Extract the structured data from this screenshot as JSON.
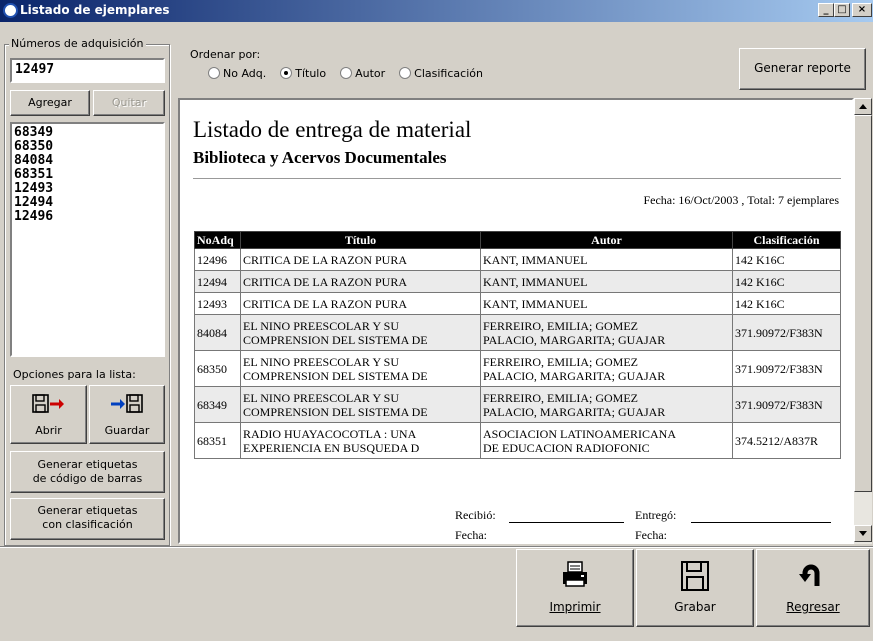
{
  "window": {
    "title": "Listado de ejemplares"
  },
  "adquisicion": {
    "group_label": "Números de adquisición",
    "input_value": "12497",
    "agregar_label": "Agregar",
    "quitar_label": "Quitar",
    "list": [
      "68349",
      "68350",
      "84084",
      "68351",
      "12493",
      "12494",
      "12496"
    ]
  },
  "opciones": {
    "label": "Opciones para la lista:",
    "abrir_label": "Abrir",
    "guardar_label": "Guardar",
    "barcode_label_1": "Generar  etiquetas",
    "barcode_label_2": "de código de barras",
    "clasif_label_1": "Generar etiquetas",
    "clasif_label_2": "con clasificación"
  },
  "ordenar": {
    "label": "Ordenar por:",
    "options": [
      "No Adq.",
      "Título",
      "Autor",
      "Clasificación"
    ],
    "selected": "Título"
  },
  "generar_reporte_label": "Generar reporte",
  "report": {
    "title": "Listado de entrega de material",
    "subtitle": "Biblioteca y Acervos Documentales",
    "fecha_line": "Fecha: 16/Oct/2003 , Total: 7 ejemplares",
    "columns": [
      "NoAdq",
      "Título",
      "Autor",
      "Clasificación"
    ],
    "rows": [
      {
        "noadq": "12496",
        "titulo_1": "CRITICA DE LA RAZON PURA",
        "titulo_2": "",
        "autor_1": "KANT, IMMANUEL",
        "autor_2": "",
        "clasif": "142 K16C"
      },
      {
        "noadq": "12494",
        "titulo_1": "CRITICA DE LA RAZON PURA",
        "titulo_2": "",
        "autor_1": "KANT, IMMANUEL",
        "autor_2": "",
        "clasif": "142 K16C"
      },
      {
        "noadq": "12493",
        "titulo_1": "CRITICA DE LA RAZON PURA",
        "titulo_2": "",
        "autor_1": "KANT, IMMANUEL",
        "autor_2": "",
        "clasif": "142 K16C"
      },
      {
        "noadq": "84084",
        "titulo_1": "EL NINO PREESCOLAR Y SU",
        "titulo_2": "COMPRENSION DEL SISTEMA DE",
        "autor_1": "FERREIRO, EMILIA; GOMEZ",
        "autor_2": "PALACIO, MARGARITA; GUAJAR",
        "clasif": "371.90972/F383N"
      },
      {
        "noadq": "68350",
        "titulo_1": "EL NINO PREESCOLAR Y SU",
        "titulo_2": "COMPRENSION DEL SISTEMA DE",
        "autor_1": "FERREIRO, EMILIA; GOMEZ",
        "autor_2": "PALACIO, MARGARITA; GUAJAR",
        "clasif": "371.90972/F383N"
      },
      {
        "noadq": "68349",
        "titulo_1": "EL NINO PREESCOLAR Y SU",
        "titulo_2": "COMPRENSION DEL SISTEMA DE",
        "autor_1": "FERREIRO, EMILIA; GOMEZ",
        "autor_2": "PALACIO, MARGARITA; GUAJAR",
        "clasif": "371.90972/F383N"
      },
      {
        "noadq": "68351",
        "titulo_1": "RADIO HUAYACOCOTLA : UNA",
        "titulo_2": "EXPERIENCIA EN BUSQUEDA D",
        "autor_1": "ASOCIACION LATINOAMERICANA",
        "autor_2": "DE EDUCACION RADIOFONIC",
        "clasif": "374.5212/A837R"
      }
    ],
    "recibio_label": "Recibió:",
    "entrego_label": "Entregó:",
    "fecha_label": "Fecha:"
  },
  "actions": {
    "imprimir_label": "Imprimir",
    "grabar_label": "Grabar",
    "regresar_label": "Regresar"
  }
}
